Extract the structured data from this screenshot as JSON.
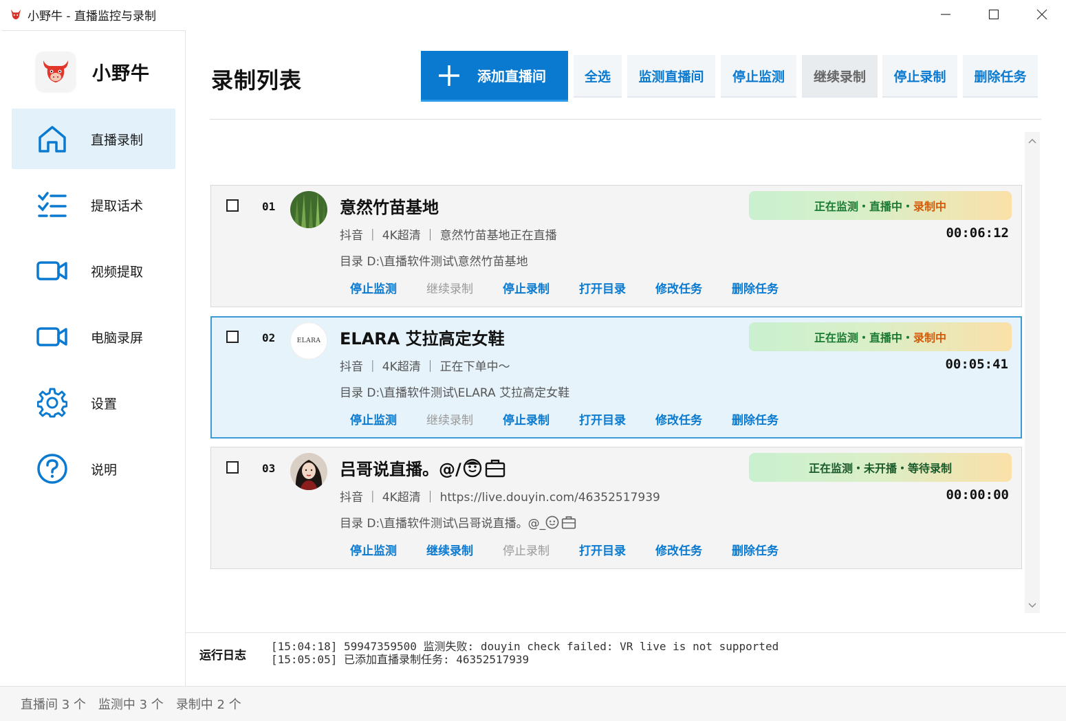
{
  "window": {
    "title": "小野牛 - 直播监控与录制",
    "controls": [
      "minimize-icon",
      "maximize-icon",
      "close-icon"
    ]
  },
  "sidebar": {
    "brand": "小野牛",
    "items": [
      {
        "label": "直播录制",
        "icon": "home-icon",
        "active": true
      },
      {
        "label": "提取话术",
        "icon": "checklist-icon",
        "active": false
      },
      {
        "label": "视频提取",
        "icon": "video-camera-icon",
        "active": false
      },
      {
        "label": "电脑录屏",
        "icon": "screen-record-icon",
        "active": false
      },
      {
        "label": "设置",
        "icon": "gear-icon",
        "active": false
      },
      {
        "label": "说明",
        "icon": "help-icon",
        "active": false
      }
    ]
  },
  "main": {
    "title": "录制列表",
    "toolbar": {
      "add": "添加直播间",
      "select_all": "全选",
      "monitor": "监测直播间",
      "stop_monitor": "停止监测",
      "resume_record": "继续录制",
      "stop_record": "停止录制",
      "delete": "删除任务"
    },
    "tasks": [
      {
        "index": "01",
        "name": "意然竹苗基地",
        "meta": "抖音 ｜ 4K超清 ｜ 意然竹苗基地正在直播",
        "dir": "目录  D:\\直播软件测试\\意然竹苗基地",
        "status_a": "正在监测・直播中・",
        "status_b": "录制中",
        "timer": "00:06:12",
        "actions": [
          "停止监测",
          "继续录制",
          "停止录制",
          "打开目录",
          "修改任务",
          "删除任务"
        ]
      },
      {
        "index": "02",
        "name": "ELARA 艾拉高定女鞋",
        "avatar_text": "ELARA",
        "meta": "抖音 ｜ 4K超清 ｜ 正在下单中～",
        "dir": "目录  D:\\直播软件测试\\ELARA 艾拉高定女鞋",
        "status_a": "正在监测・直播中・",
        "status_b": "录制中",
        "timer": "00:05:41",
        "actions": [
          "停止监测",
          "继续录制",
          "停止录制",
          "打开目录",
          "修改任务",
          "删除任务"
        ]
      },
      {
        "index": "03",
        "name": "吕哥说直播。@/",
        "meta": "抖音 ｜ 4K超清 ｜ https://live.douyin.com/46352517939",
        "dir": "目录  D:\\直播软件测试\\吕哥说直播。@_",
        "status": "正在监测・未开播・等待录制",
        "timer": "00:00:00",
        "actions": [
          "停止监测",
          "继续录制",
          "停止录制",
          "打开目录",
          "修改任务",
          "删除任务"
        ]
      }
    ]
  },
  "log": {
    "label": "运行日志",
    "lines": [
      "[15:04:18] 59947359500 监测失败: douyin check failed: VR live is not supported",
      "[15:05:05] 已添加直播录制任务: 46352517939"
    ]
  },
  "statusbar": {
    "rooms": "直播间 3 个",
    "monitoring": "监测中 3 个",
    "recording": "录制中 2 个"
  },
  "colors": {
    "accent": "#0a7ad0",
    "active_nav": "#e3f1fb",
    "recording": "#d55a08",
    "monitoring": "#1a7a32"
  }
}
